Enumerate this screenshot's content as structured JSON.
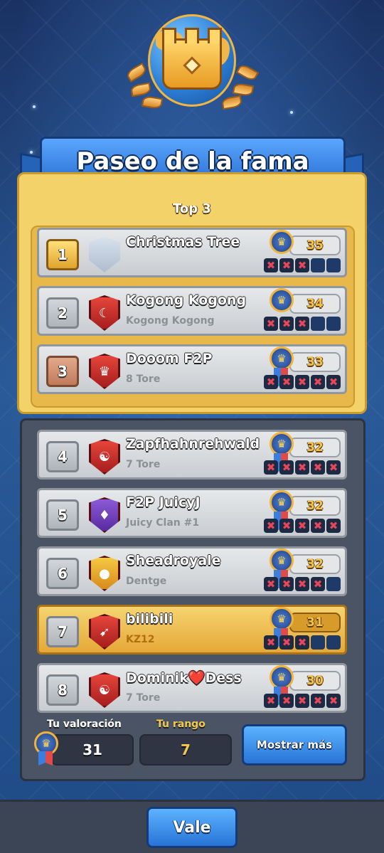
{
  "title": "Paseo de la fama",
  "top_label": "Top 3",
  "rows": [
    {
      "rank": "1",
      "name": "Christmas Tree",
      "clan": "",
      "score": "35",
      "crosses": 3
    },
    {
      "rank": "2",
      "name": "Kogong Kogong",
      "clan": "Kogong Kogong",
      "score": "34",
      "crosses": 3
    },
    {
      "rank": "3",
      "name": "Dooom F2P",
      "clan": "8 Tore",
      "score": "33",
      "crosses": 5
    },
    {
      "rank": "4",
      "name": "Zapfhahnrehwald",
      "clan": "7 Tore",
      "score": "32",
      "crosses": 5
    },
    {
      "rank": "5",
      "name": "F2P JuicyJ",
      "clan": "Juicy Clan #1",
      "score": "32",
      "crosses": 5
    },
    {
      "rank": "6",
      "name": "Sheadroyale",
      "clan": "Dentge",
      "score": "32",
      "crosses": 4
    },
    {
      "rank": "7",
      "name": "bilibili",
      "clan": "KZ12",
      "score": "31",
      "crosses": 3
    },
    {
      "rank": "8",
      "name": "Dominik❤️Dess",
      "clan": "7 Tore",
      "score": "30",
      "crosses": 5
    }
  ],
  "footer": {
    "rating_label": "Tu valoración",
    "rating_value": "31",
    "rank_label": "Tu rango",
    "rank_value": "7",
    "show_more": "Mostrar más"
  },
  "ok_button": "Vale",
  "colors": {
    "accent_blue": "#2a6fd0",
    "gold": "#f3d26a",
    "panel": "#4a5464",
    "cross": "#e8475a"
  }
}
